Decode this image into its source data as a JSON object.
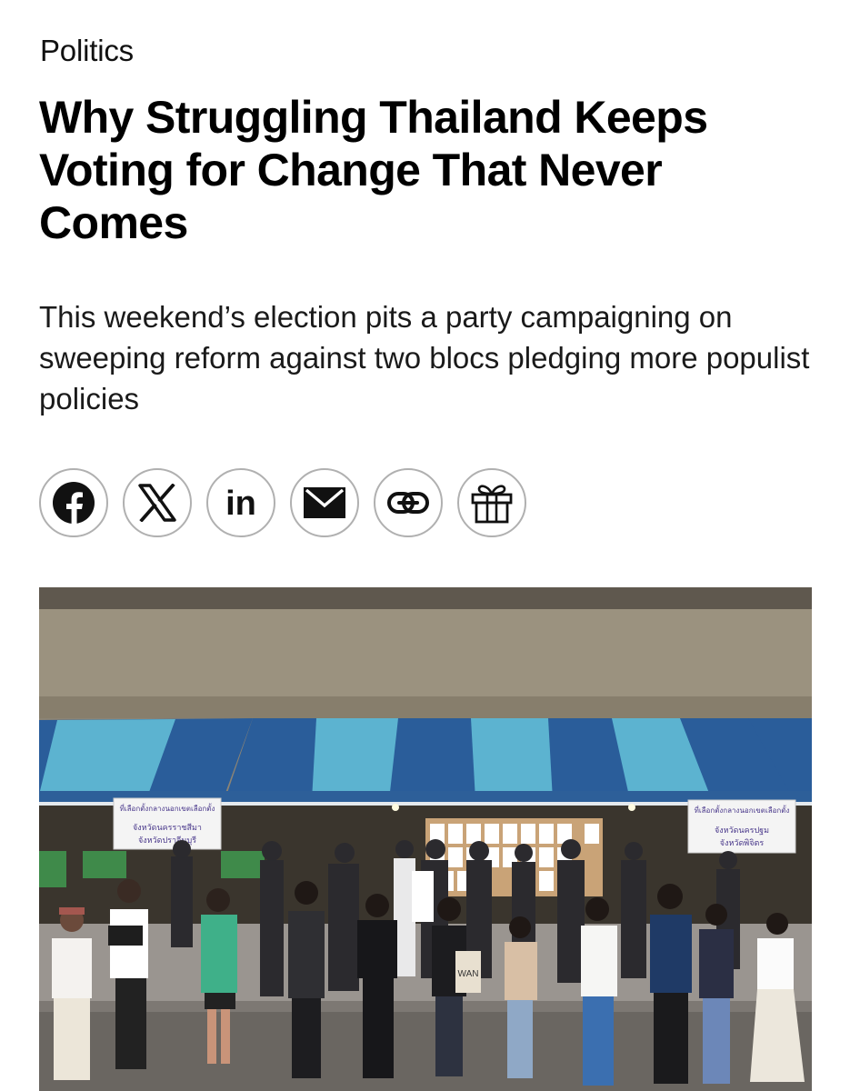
{
  "article": {
    "section": "Politics",
    "headline": "Why Struggling Thailand Keeps Voting for Change That Never Comes",
    "dek": "This weekend’s election pits a party campaigning on sweeping reform against two blocs pledging more populist policies"
  },
  "share_buttons": [
    {
      "icon": "facebook-icon"
    },
    {
      "icon": "x-icon"
    },
    {
      "icon": "linkedin-icon",
      "text": "in"
    },
    {
      "icon": "email-icon"
    },
    {
      "icon": "link-icon"
    },
    {
      "icon": "gift-icon"
    }
  ],
  "hero_image": {
    "signs": [
      "ที่เลือกตั้งกลางนอกเขตเลือกตั้ง",
      "จังหวัดนครราชสีมา",
      "จังหวัดปราจีนบุรี",
      "ที่เลือกตั้งกลางนอกเขตเลือกตั้ง",
      "จังหวัดนครปฐม",
      "จังหวัดพิจิตร"
    ],
    "bag_text": "WAN"
  },
  "colors": {
    "text": "#111111",
    "share_border": "#b0b0b0",
    "tent_dark_blue": "#2a5d9a",
    "tent_light_blue": "#5cb3d0"
  }
}
